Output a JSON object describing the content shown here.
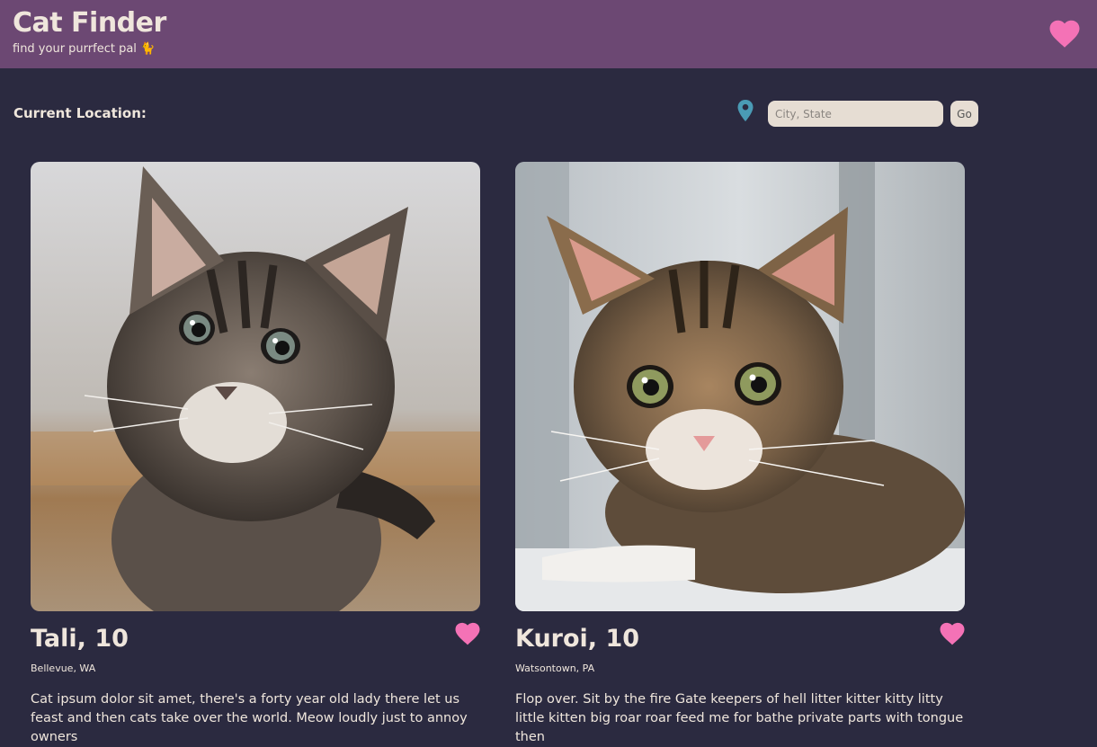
{
  "header": {
    "title": "Cat Finder",
    "subtitle": "find your purrfect pal 🐈",
    "favorites_icon": "heart-icon"
  },
  "colors": {
    "header_bg": "#6c4873",
    "page_bg": "#2b2a40",
    "text": "#efe6dc",
    "heart": "#f472b6",
    "pin": "#4a9bb5",
    "input_bg": "#e6ddd3"
  },
  "location": {
    "label": "Current Location:",
    "pin_icon": "map-pin-icon",
    "placeholder": "City, State",
    "value": "",
    "go_label": "Go"
  },
  "cats": [
    {
      "name": "Tali, 10",
      "location": "Bellevue, WA",
      "description": "Cat ipsum dolor sit amet, there's a forty year old lady there let us feast and then cats take over the world. Meow loudly just to annoy owners",
      "photo": "fluffy grey tabby kitten photo",
      "favorite_icon": "heart-icon"
    },
    {
      "name": "Kuroi, 10",
      "location": "Watsontown, PA",
      "description": "Flop over. Sit by the fire Gate keepers of hell litter kitter kitty litty little kitten big roar roar feed me for bathe private parts with tongue then",
      "photo": "brown tabby kitten by window photo",
      "favorite_icon": "heart-icon"
    }
  ]
}
